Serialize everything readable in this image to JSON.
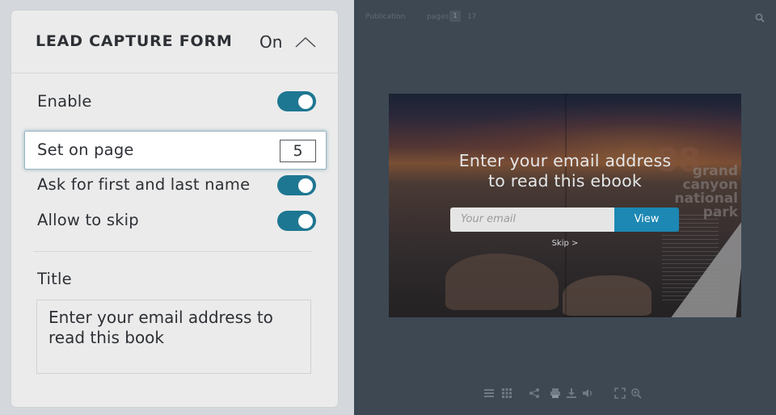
{
  "panel": {
    "title": "LEAD CAPTURE FORM",
    "state": "On",
    "enable_label": "Enable",
    "set_on_page_label": "Set on page",
    "page_value": "5",
    "ask_name_label": "Ask for first and last name",
    "allow_skip_label": "Allow to skip",
    "title_label": "Title",
    "title_value": "Enter your email address to\nread this book",
    "toggles": {
      "enable": true,
      "ask_name": true,
      "allow_skip": true
    },
    "accent_color": "#1e7792"
  },
  "preview": {
    "toolbar": {
      "publication_label": "Publication",
      "pages_label": "pages",
      "current_page": "1",
      "total_pages": "17"
    },
    "ebook": {
      "cover_number": "88",
      "cover_title": "grand canyon national park",
      "overlay_title": "Enter your email address\nto read this ebook",
      "email_placeholder": "Your email",
      "view_button": "View",
      "skip_link": "Skip >",
      "button_color": "#1c88b3"
    },
    "bottom_icons": [
      "list-icon",
      "grid-icon",
      "share-icon",
      "print-icon",
      "download-icon",
      "sound-icon",
      "fullscreen-icon",
      "zoom-icon"
    ]
  }
}
